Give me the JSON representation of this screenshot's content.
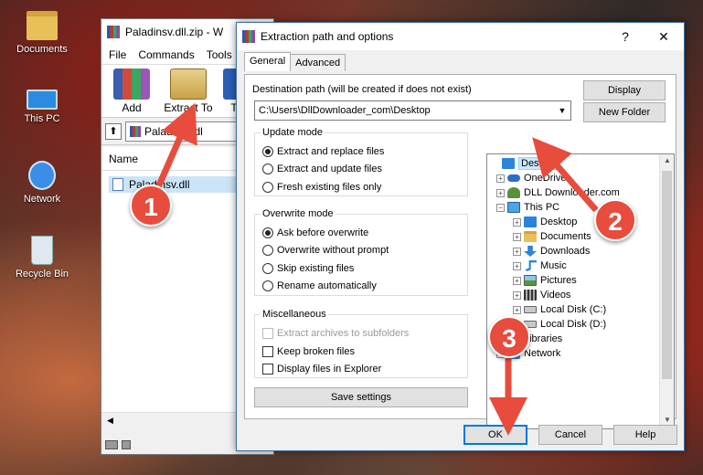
{
  "desktop": {
    "icons": [
      {
        "label": "Documents",
        "icon": "folder-icon"
      },
      {
        "label": "This PC",
        "icon": "computer-icon"
      },
      {
        "label": "Network",
        "icon": "network-icon"
      },
      {
        "label": "Recycle Bin",
        "icon": "recycle-bin-icon"
      }
    ]
  },
  "rar": {
    "title": "Paladinsv.dll.zip - W",
    "menu": [
      "File",
      "Commands",
      "Tools"
    ],
    "toolbar": {
      "add": "Add",
      "extract_to": "Extract To",
      "third": "T"
    },
    "path": "Paladinsv.dl",
    "column_name": "Name",
    "file_name": "Paladinsv.dll"
  },
  "dialog": {
    "title": "Extraction path and options",
    "help_symbol": "?",
    "close_symbol": "✕",
    "tabs": [
      "General",
      "Advanced"
    ],
    "dest_label": "Destination path (will be created if does not exist)",
    "dest_value": "C:\\Users\\DllDownloader_com\\Desktop",
    "btn_display": "Display",
    "btn_new_folder": "New Folder",
    "update_mode": {
      "title": "Update mode",
      "options": [
        "Extract and replace files",
        "Extract and update files",
        "Fresh existing files only"
      ],
      "selected": 0
    },
    "overwrite_mode": {
      "title": "Overwrite mode",
      "options": [
        "Ask before overwrite",
        "Overwrite without prompt",
        "Skip existing files",
        "Rename automatically"
      ],
      "selected": 0
    },
    "misc": {
      "title": "Miscellaneous",
      "options": [
        "Extract archives to subfolders",
        "Keep broken files",
        "Display files in Explorer"
      ]
    },
    "btn_save": "Save settings",
    "tree": [
      {
        "label": "Desktop",
        "icon": "desktop"
      },
      {
        "label": "OneDrive",
        "icon": "cloud"
      },
      {
        "label": "DLL Downloader.com",
        "icon": "user"
      },
      {
        "label": "This PC",
        "icon": "pc"
      },
      {
        "label": "Desktop",
        "icon": "desktop"
      },
      {
        "label": "Documents",
        "icon": "folder"
      },
      {
        "label": "Downloads",
        "icon": "down"
      },
      {
        "label": "Music",
        "icon": "music"
      },
      {
        "label": "Pictures",
        "icon": "pic"
      },
      {
        "label": "Videos",
        "icon": "vid"
      },
      {
        "label": "Local Disk (C:)",
        "icon": "disk"
      },
      {
        "label": "Local Disk (D:)",
        "icon": "disk"
      },
      {
        "label": "Libraries",
        "icon": "lib"
      },
      {
        "label": "Network",
        "icon": "net"
      }
    ],
    "btn_ok": "OK",
    "btn_cancel": "Cancel",
    "btn_help": "Help"
  },
  "annotations": {
    "step1": "1",
    "step2": "2",
    "step3": "3",
    "color": "#e74c3c"
  }
}
